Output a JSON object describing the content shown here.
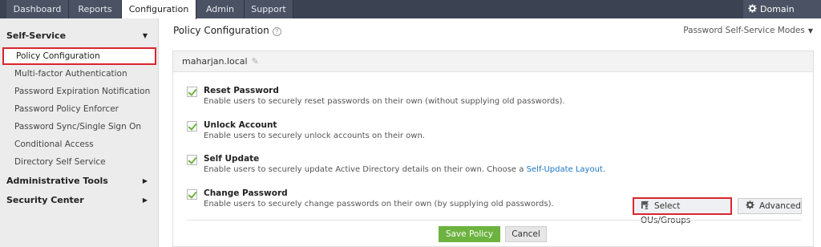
{
  "nav": {
    "tabs": [
      {
        "label": "Dashboard"
      },
      {
        "label": "Reports"
      },
      {
        "label": "Configuration"
      },
      {
        "label": "Admin"
      },
      {
        "label": "Support"
      }
    ],
    "active_tab": "Configuration",
    "domain_settings": "Domain Settings"
  },
  "sidebar": {
    "self_service": "Self-Service",
    "items": [
      {
        "label": "Policy Configuration"
      },
      {
        "label": "Multi-factor Authentication"
      },
      {
        "label": "Password Expiration Notification"
      },
      {
        "label": "Password Policy Enforcer"
      },
      {
        "label": "Password Sync/Single Sign On"
      },
      {
        "label": "Conditional Access"
      },
      {
        "label": "Directory Self Service"
      }
    ],
    "administrative_tools": "Administrative Tools",
    "security_center": "Security Center"
  },
  "main": {
    "title": "Policy Configuration",
    "help_glyph": "?",
    "modes_label": "Password Self-Service Modes",
    "domain": "maharjan.local",
    "features": [
      {
        "title": "Reset Password",
        "desc": "Enable users to securely reset passwords on their own (without supplying old passwords).",
        "checked": true
      },
      {
        "title": "Unlock Account",
        "desc": "Enable users to securely unlock accounts on their own.",
        "checked": true
      },
      {
        "title": "Self Update",
        "desc": "Enable users to securely update Active Directory details on their own. Choose a ",
        "link": "Self-Update Layout.",
        "checked": true
      },
      {
        "title": "Change Password",
        "desc": "Enable users to securely change passwords on their own (by supplying old passwords).",
        "checked": true
      }
    ],
    "select_ous": "Select OUs/Groups",
    "advanced": "Advanced",
    "save": "Save Policy",
    "cancel": "Cancel"
  },
  "colors": {
    "nav_bg": "#3b4252",
    "accent_green": "#6cb33f",
    "highlight_red": "#d9262c",
    "link_blue": "#1a76c2"
  }
}
